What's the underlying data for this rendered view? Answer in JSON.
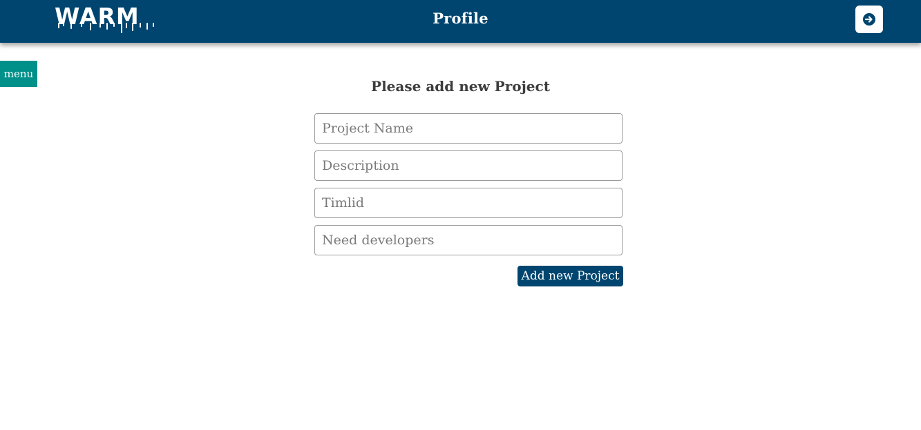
{
  "header": {
    "logo_text": "WARM",
    "title": "Profile",
    "logout_icon": "arrow-right-circle-icon",
    "background_color": "#00456f"
  },
  "sidebar": {
    "menu_label": "menu",
    "menu_color": "#00908a"
  },
  "form": {
    "heading": "Please add new Project",
    "fields": [
      {
        "placeholder": "Project Name",
        "value": ""
      },
      {
        "placeholder": "Description",
        "value": ""
      },
      {
        "placeholder": "Timlid",
        "value": ""
      },
      {
        "placeholder": "Need developers",
        "value": ""
      }
    ],
    "submit_label": "Add new Project"
  }
}
